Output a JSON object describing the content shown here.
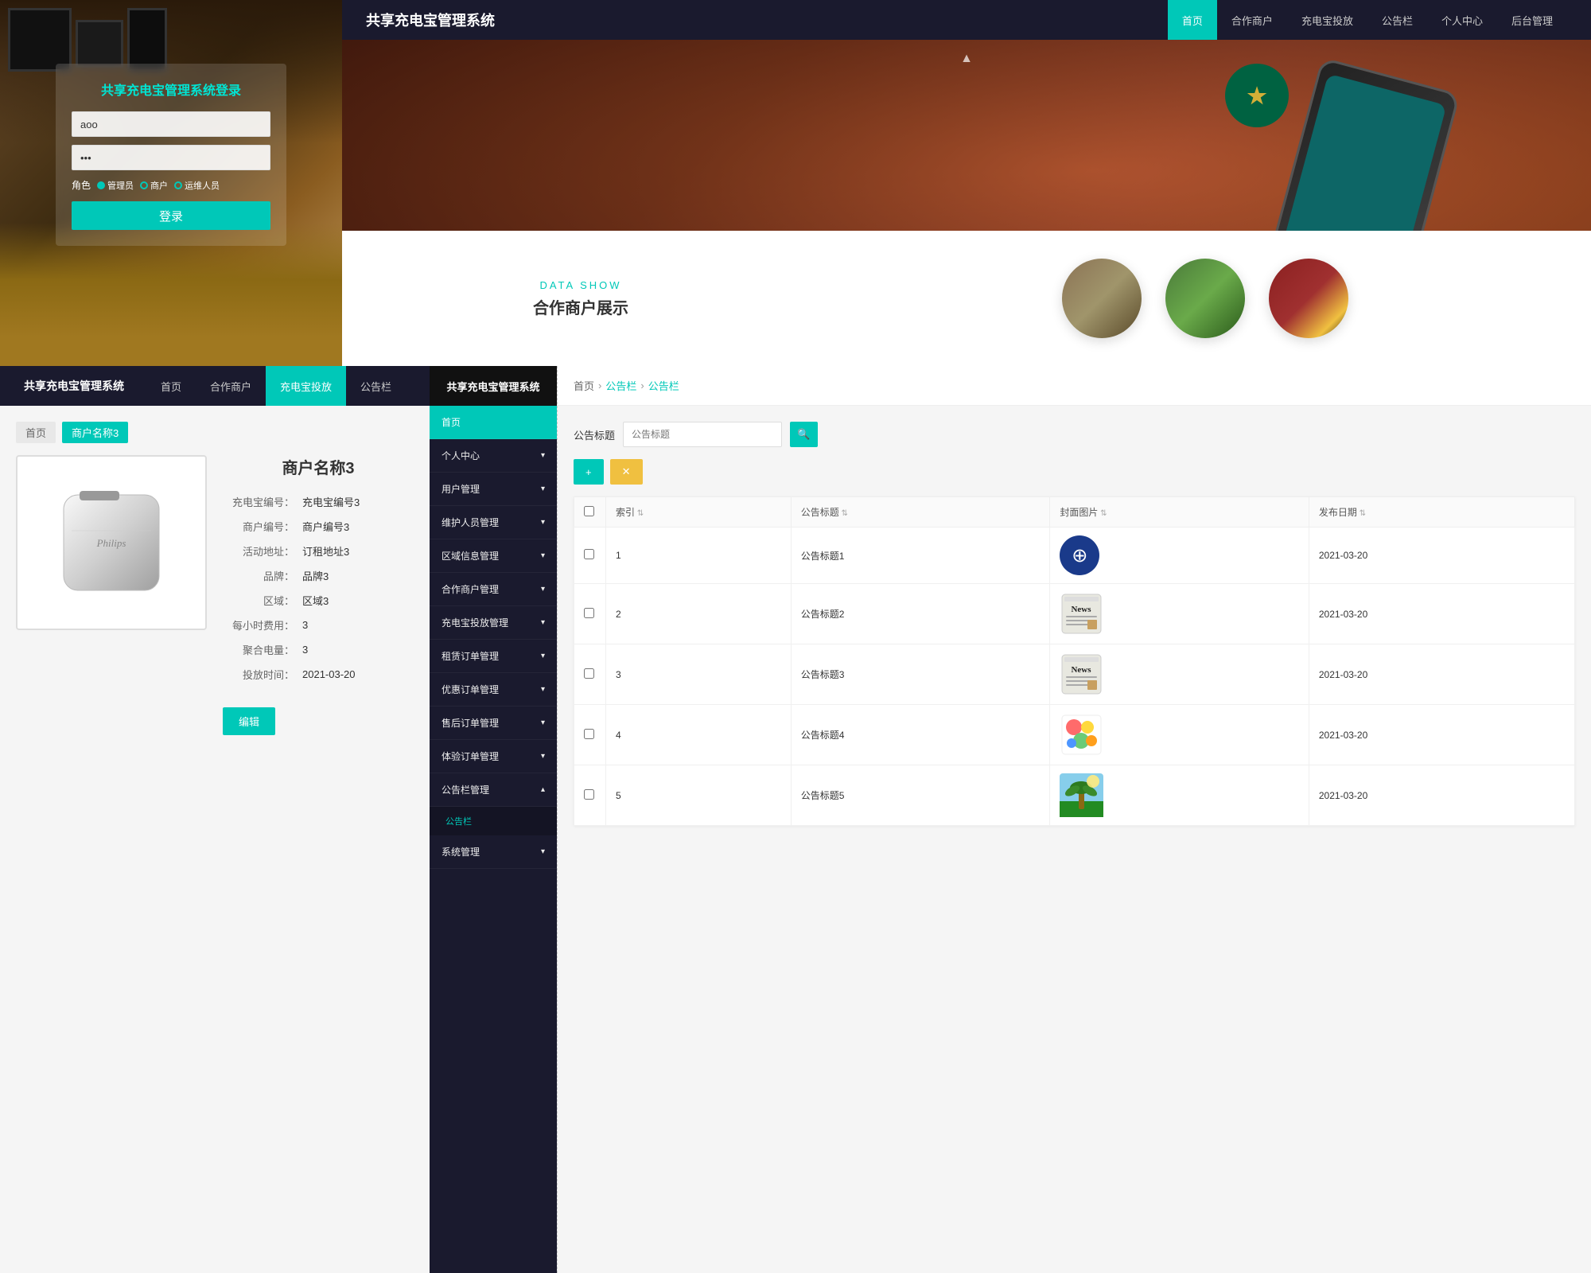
{
  "login": {
    "title": "共享充电宝管理系统登录",
    "username_placeholder": "aoo",
    "password_value": "...",
    "role_label": "角色",
    "role_options": [
      "管理员",
      "商户",
      "运维人员"
    ],
    "submit_label": "登录"
  },
  "site_header": {
    "logo": "共享充电宝管理系统",
    "nav": [
      {
        "label": "首页",
        "active": true
      },
      {
        "label": "合作商户"
      },
      {
        "label": "充电宝投放"
      },
      {
        "label": "公告栏"
      },
      {
        "label": "个人中心"
      },
      {
        "label": "后台管理"
      }
    ]
  },
  "data_show": {
    "subtitle": "DATA SHOW",
    "title": "合作商户展示"
  },
  "charger_detail": {
    "logo": "共享充电宝管理系统",
    "nav": [
      "首页",
      "合作商户",
      "充电宝投放",
      "公告栏"
    ],
    "breadcrumb": [
      "首页",
      "商户名称3"
    ],
    "merchant_name": "商户名称3",
    "fields": [
      {
        "label": "充电宝编号：",
        "value": "充电宝编号3"
      },
      {
        "label": "商户编号：",
        "value": "商户编号3"
      },
      {
        "label": "活动地址：",
        "value": "订租地址3"
      },
      {
        "label": "品牌：",
        "value": "品牌3"
      },
      {
        "label": "区域：",
        "value": "区域3"
      },
      {
        "label": "每小时费用：",
        "value": "3"
      },
      {
        "label": "聚合电量：",
        "value": "3"
      },
      {
        "label": "投放时间：",
        "value": "2021-03-20"
      }
    ],
    "edit_btn": "编辑"
  },
  "sidebar": {
    "logo": "共享充电宝管理系统",
    "items": [
      {
        "label": "首页",
        "active": true,
        "type": "link"
      },
      {
        "label": "个人中心",
        "type": "group"
      },
      {
        "label": "用户管理",
        "type": "group"
      },
      {
        "label": "维护人员管理",
        "type": "group"
      },
      {
        "label": "区域信息管理",
        "type": "group"
      },
      {
        "label": "合作商户管理",
        "type": "group"
      },
      {
        "label": "充电宝投放管理",
        "type": "group"
      },
      {
        "label": "租赁订单管理",
        "type": "group"
      },
      {
        "label": "优惠订单管理",
        "type": "group"
      },
      {
        "label": "售后订单管理",
        "type": "group"
      },
      {
        "label": "体验订单管理",
        "type": "group"
      },
      {
        "label": "公告栏管理",
        "type": "group",
        "expanded": true
      },
      {
        "label": "公告栏",
        "type": "sub",
        "active": true
      },
      {
        "label": "系统管理",
        "type": "group"
      }
    ]
  },
  "announcements": {
    "breadcrumb": [
      "首页",
      "公告栏",
      "公告栏"
    ],
    "filter_label": "公告标题",
    "filter_placeholder": "公告标题",
    "search_btn": "🔍",
    "add_btn": "+",
    "del_btn": "☓",
    "table_headers": [
      "索引",
      "公告标题",
      "封面图片",
      "发布日期"
    ],
    "rows": [
      {
        "id": 1,
        "title": "公告标题1",
        "date": "2021-03-20",
        "thumb_type": "globe"
      },
      {
        "id": 2,
        "title": "公告标题2",
        "date": "2021-03-20",
        "thumb_type": "news"
      },
      {
        "id": 3,
        "title": "公告标题3",
        "date": "2021-03-20",
        "thumb_type": "news"
      },
      {
        "id": 4,
        "title": "公告标题4",
        "date": "2021-03-20",
        "thumb_type": "color"
      },
      {
        "id": 5,
        "title": "公告标题5",
        "date": "2021-03-20",
        "thumb_type": "palm"
      }
    ]
  }
}
